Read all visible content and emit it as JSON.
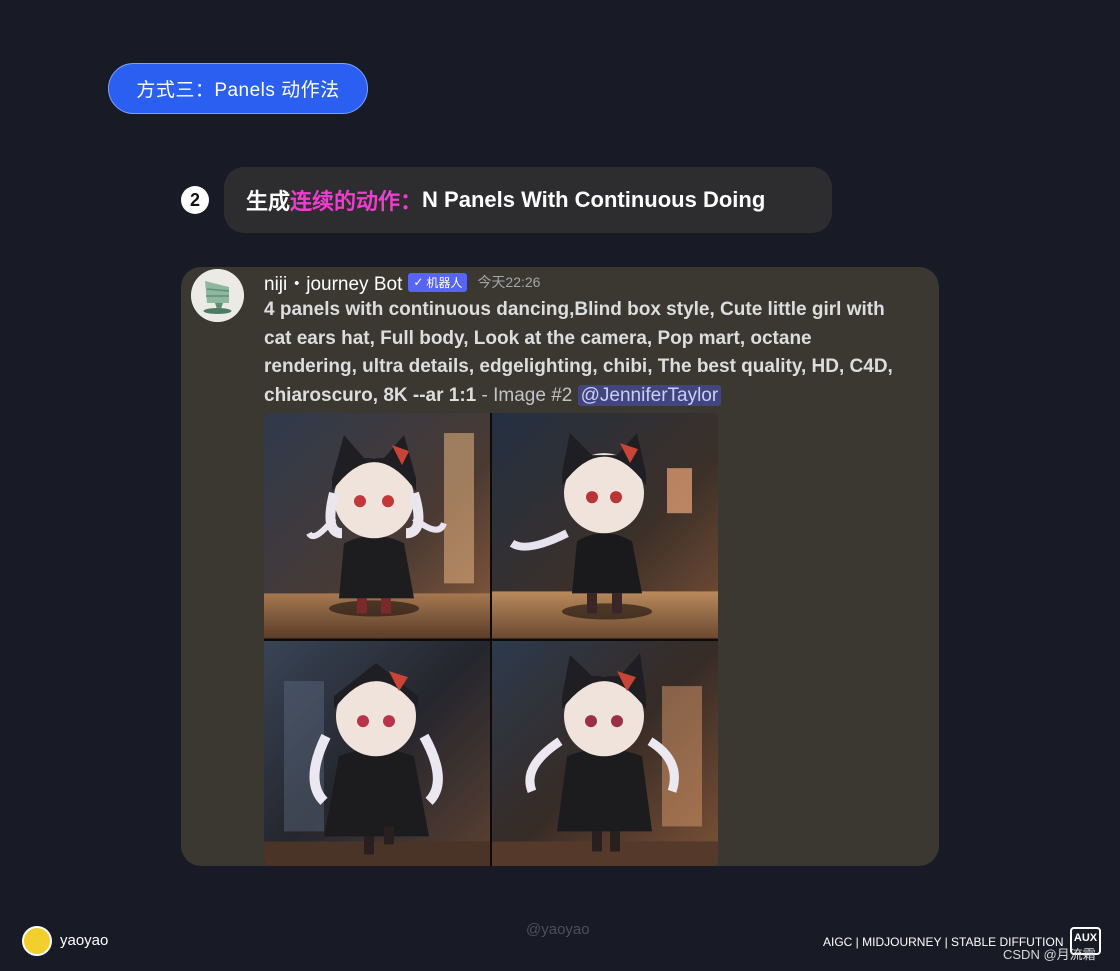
{
  "section": {
    "label": "方式三：Panels 动作法"
  },
  "step": {
    "number": "2",
    "title_prefix": "生成",
    "title_accent": "连续的动作：",
    "title_suffix": "N Panels With Continuous Doing"
  },
  "message": {
    "author": "niji・journey Bot",
    "bot_tag": "机器人",
    "timestamp": "今天22:26",
    "prompt": "4 panels with continuous dancing,Blind box style, Cute little girl with cat ears hat, Full body, Look at the camera, Pop mart, octane rendering, ultra details, edgelighting, chibi, The best quality, HD, C4D, chiaroscuro, 8K --ar 1:1",
    "image_label": " - Image #2 ",
    "mention": "@JenniferTaylor"
  },
  "footer": {
    "brand": "yaoyao",
    "watermark": "@yaoyao",
    "tags": "AIGC | MIDJOURNEY | STABLE DIFFUTION",
    "aux": "AUX",
    "credit": "CSDN @月流霜"
  },
  "colors": {
    "background": "#181a25",
    "pill": "#2b5ff2",
    "accent": "#f03ccf",
    "card": "#3a3831",
    "bot_tag": "#5865f2",
    "mention_bg": "#43467c"
  }
}
